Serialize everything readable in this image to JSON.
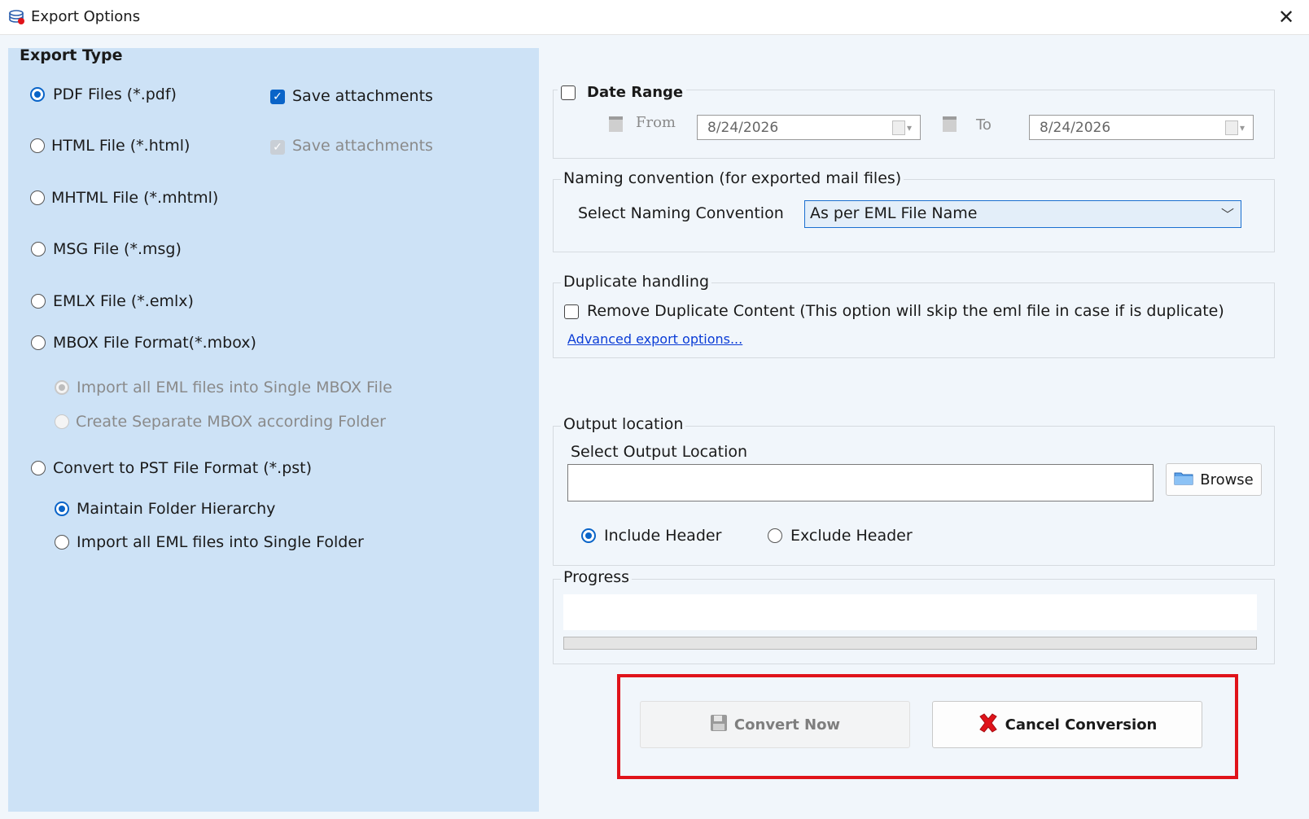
{
  "window": {
    "title": "Export Options",
    "close_symbol": "✕"
  },
  "export_type": {
    "heading": "Export Type",
    "options": [
      {
        "label": "PDF Files (*.pdf)",
        "selected": true
      },
      {
        "label": "HTML File  (*.html)",
        "selected": false
      },
      {
        "label": "MHTML File  (*.mhtml)",
        "selected": false
      },
      {
        "label": "MSG File (*.msg)",
        "selected": false
      },
      {
        "label": "EMLX File (*.emlx)",
        "selected": false
      },
      {
        "label": "MBOX File Format(*.mbox)",
        "selected": false
      },
      {
        "label": "Convert to PST File Format (*.pst)",
        "selected": false
      }
    ],
    "pdf_save_attachments": {
      "label": "Save attachments",
      "checked": true,
      "enabled": true
    },
    "html_save_attachments": {
      "label": "Save attachments",
      "checked": true,
      "enabled": false
    },
    "mbox_suboptions": [
      {
        "label": "Import all EML files into Single MBOX File",
        "selected": true,
        "enabled": false
      },
      {
        "label": "Create Separate MBOX according Folder",
        "selected": false,
        "enabled": false
      }
    ],
    "pst_suboptions": [
      {
        "label": "Maintain Folder Hierarchy",
        "selected": true,
        "enabled": true
      },
      {
        "label": "Import all EML files into Single Folder",
        "selected": false,
        "enabled": true
      }
    ]
  },
  "date_range": {
    "label": "Date Range",
    "checked": false,
    "from_label": "From",
    "from_value": "8/24/2026",
    "to_label": "To",
    "to_value": "8/24/2026"
  },
  "naming": {
    "group_title": "Naming convention (for exported mail files)",
    "label": "Select Naming Convention",
    "selected_value": "As per EML File Name"
  },
  "duplicate": {
    "group_title": "Duplicate handling",
    "checkbox_label": "Remove Duplicate Content (This option will skip the eml file in case if is duplicate)",
    "checked": false,
    "advanced_link": "Advanced export options..."
  },
  "output": {
    "group_title": "Output location",
    "label": "Select Output Location",
    "path_value": "",
    "browse_label": "Browse",
    "header_options": [
      {
        "label": "Include Header",
        "selected": true
      },
      {
        "label": "Exclude Header",
        "selected": false
      }
    ]
  },
  "progress": {
    "group_title": "Progress",
    "status_text": "",
    "fraction": 0
  },
  "actions": {
    "convert_label": "Convert Now",
    "convert_enabled": false,
    "cancel_label": "Cancel Conversion",
    "highlight_color": "#e0131a"
  },
  "colors": {
    "accent": "#0a64c8",
    "left_panel": "#cde2f6",
    "dialog_bg": "#f1f6fb",
    "cancel_icon": "#e0131a"
  }
}
